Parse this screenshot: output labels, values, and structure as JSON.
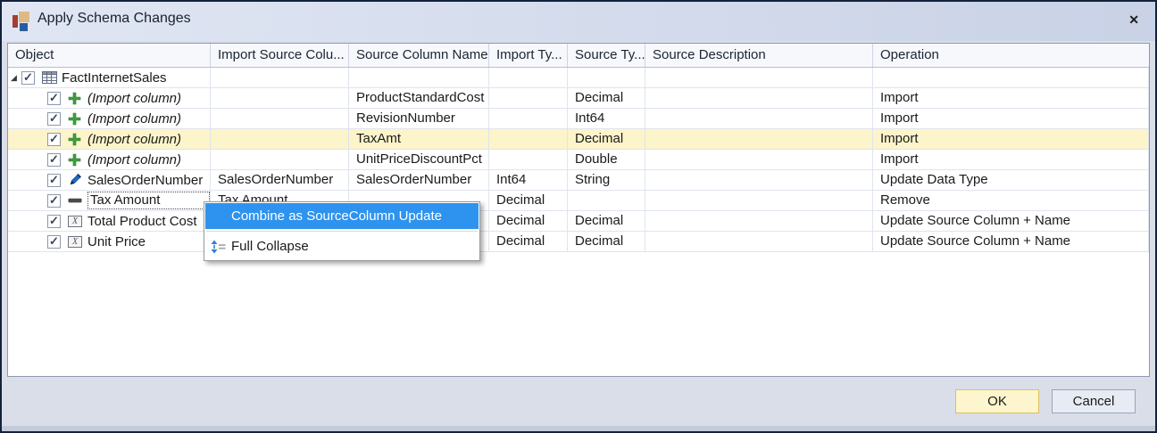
{
  "window": {
    "title": "Apply Schema Changes",
    "close_glyph": "✕"
  },
  "grid": {
    "columns": [
      {
        "label": "Object"
      },
      {
        "label": "Import Source Colu..."
      },
      {
        "label": "Source Column Name"
      },
      {
        "label": "Import Ty..."
      },
      {
        "label": "Source Ty..."
      },
      {
        "label": "Source Description"
      },
      {
        "label": "Operation"
      }
    ],
    "rows": [
      {
        "object": "FactInternetSales",
        "icon": "table-icon",
        "checked": true,
        "level": 0,
        "import_source_column": "",
        "source_column_name": "",
        "import_type": "",
        "source_type": "",
        "source_description": "",
        "operation": ""
      },
      {
        "object": "(Import column)",
        "icon": "add-icon",
        "checked": true,
        "level": 1,
        "style": "italic",
        "import_source_column": "",
        "source_column_name": "ProductStandardCost",
        "import_type": "",
        "source_type": "Decimal",
        "source_description": "",
        "operation": "Import"
      },
      {
        "object": "(Import column)",
        "icon": "add-icon",
        "checked": true,
        "level": 1,
        "style": "italic",
        "import_source_column": "",
        "source_column_name": "RevisionNumber",
        "import_type": "",
        "source_type": "Int64",
        "source_description": "",
        "operation": "Import"
      },
      {
        "object": "(Import column)",
        "icon": "add-icon",
        "checked": true,
        "level": 1,
        "style": "italic",
        "highlighted": true,
        "import_source_column": "",
        "source_column_name": "TaxAmt",
        "import_type": "",
        "source_type": "Decimal",
        "source_description": "",
        "operation": "Import"
      },
      {
        "object": "(Import column)",
        "icon": "add-icon",
        "checked": true,
        "level": 1,
        "style": "italic",
        "import_source_column": "",
        "source_column_name": "UnitPriceDiscountPct",
        "import_type": "",
        "source_type": "Double",
        "source_description": "",
        "operation": "Import"
      },
      {
        "object": "SalesOrderNumber",
        "icon": "edit-icon",
        "checked": true,
        "level": 1,
        "import_source_column": "SalesOrderNumber",
        "source_column_name": "SalesOrderNumber",
        "import_type": "Int64",
        "source_type": "String",
        "source_description": "",
        "operation": "Update Data Type"
      },
      {
        "object": "Tax Amount",
        "icon": "remove-icon",
        "checked": true,
        "level": 1,
        "focused": true,
        "import_source_column": "Tax Amount",
        "source_column_name": "",
        "import_type": "Decimal",
        "source_type": "",
        "source_description": "",
        "operation": "Remove"
      },
      {
        "object": "Total Product Cost",
        "icon": "rename-icon",
        "checked": true,
        "level": 1,
        "import_source_column": "",
        "source_column_name": "",
        "import_type": "Decimal",
        "source_type": "Decimal",
        "source_description": "",
        "operation": "Update Source Column + Name"
      },
      {
        "object": "Unit Price",
        "icon": "rename-icon",
        "checked": true,
        "level": 1,
        "import_source_column": "",
        "source_column_name": "",
        "import_type": "Decimal",
        "source_type": "Decimal",
        "source_description": "",
        "operation": "Update Source Column + Name"
      }
    ]
  },
  "context_menu": {
    "items": [
      {
        "label": "Combine as SourceColumn Update",
        "highlighted": true
      },
      {
        "label": "Full Collapse",
        "icon": "collapse-icon",
        "highlighted": false
      }
    ]
  },
  "footer": {
    "ok_label": "OK",
    "cancel_label": "Cancel"
  },
  "colors": {
    "menu_highlight": "#2e93ee",
    "row_highlight": "#fcf4ca",
    "ok_button_bg": "#fdf5cd",
    "title_bar": "#d3dbeb"
  }
}
